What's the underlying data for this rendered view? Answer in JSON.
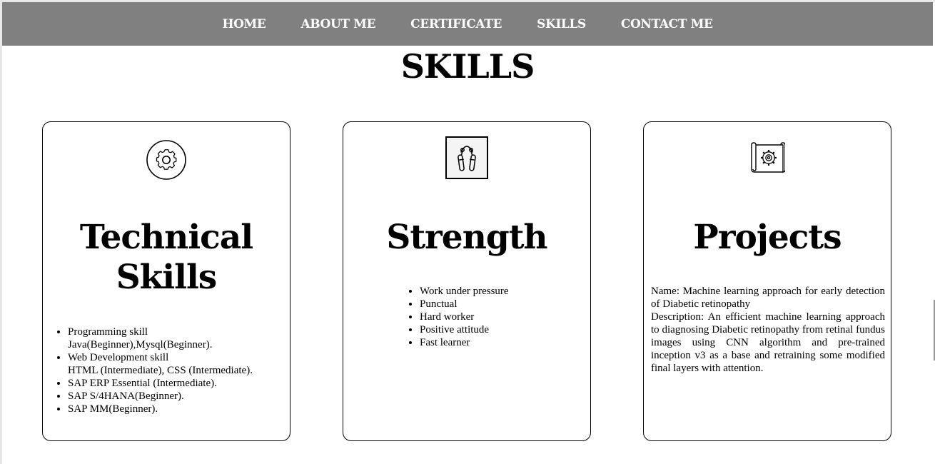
{
  "nav": {
    "items": [
      {
        "label": "HOME"
      },
      {
        "label": "ABOUT ME"
      },
      {
        "label": "CERTIFICATE"
      },
      {
        "label": "SKILLS"
      },
      {
        "label": "CONTACT ME"
      }
    ]
  },
  "page": {
    "title": "SKILLS"
  },
  "cards": [
    {
      "icon": "gear-icon",
      "title_line1": "Technical",
      "title_line2": "Skills",
      "items": [
        {
          "line1": "Programming skill",
          "line2": "Java(Beginner),Mysql(Beginner)."
        },
        {
          "line1": "Web Development skill",
          "line2": "HTML (Intermediate), CSS (Intermediate)."
        },
        {
          "line1": "SAP ERP Essential (Intermediate)."
        },
        {
          "line1": "SAP S/4HANA(Beginner)."
        },
        {
          "line1": "SAP MM(Beginner)."
        }
      ]
    },
    {
      "icon": "hand-gripper-icon",
      "title": "Strength",
      "items": [
        "Work under pressure",
        "Punctual",
        "Hard worker",
        "Positive attitude",
        "Fast learner"
      ]
    },
    {
      "icon": "blueprint-gear-icon",
      "title": "Projects",
      "name_text": "Name: Machine learning approach for early detection of Diabetic retinopathy",
      "description_text": "Description: An efficient machine learning approach to diagnosing Diabetic retinopathy from retinal fundus images using CNN algorithm and pre-trained inception v3 as a base and retraining some modified final layers with attention."
    }
  ],
  "colors": {
    "navbar_bg": "#808080",
    "nav_text": "#ffffff",
    "card_border": "#000000",
    "page_bg": "#ffffff"
  }
}
